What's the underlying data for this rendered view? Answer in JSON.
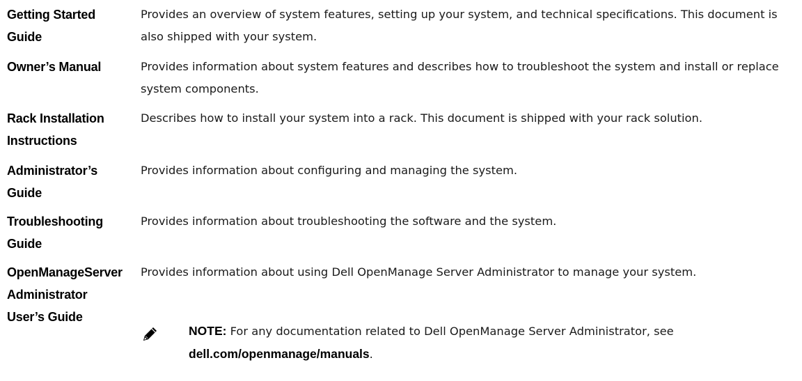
{
  "rows": [
    {
      "term": "Getting Started Guide",
      "description": "Provides an overview of system features, setting up your system, and technical specifications. This document is also shipped with your system."
    },
    {
      "term": "Owner’s Manual",
      "description": "Provides information about system features and describes how to troubleshoot the system and install or replace system components."
    },
    {
      "term": "Rack Installation Instructions",
      "description": "Describes how to install your system into a rack. This document is shipped with your rack solution."
    },
    {
      "term": "Administrator’s Guide",
      "description": "Provides information about configuring and managing the system."
    },
    {
      "term": "Troubleshooting Guide",
      "description": "Provides information about troubleshooting the software and the system."
    },
    {
      "term": "OpenManageServer Administrator User’s Guide",
      "description": "Provides information about using Dell OpenManage Server Administrator to manage your system."
    }
  ],
  "note": {
    "icon": "pencil-icon",
    "label": "NOTE:",
    "text": " For any documentation related to Dell OpenManage Server Administrator, see ",
    "link": "dell.com/openmanage/manuals",
    "end": "."
  }
}
